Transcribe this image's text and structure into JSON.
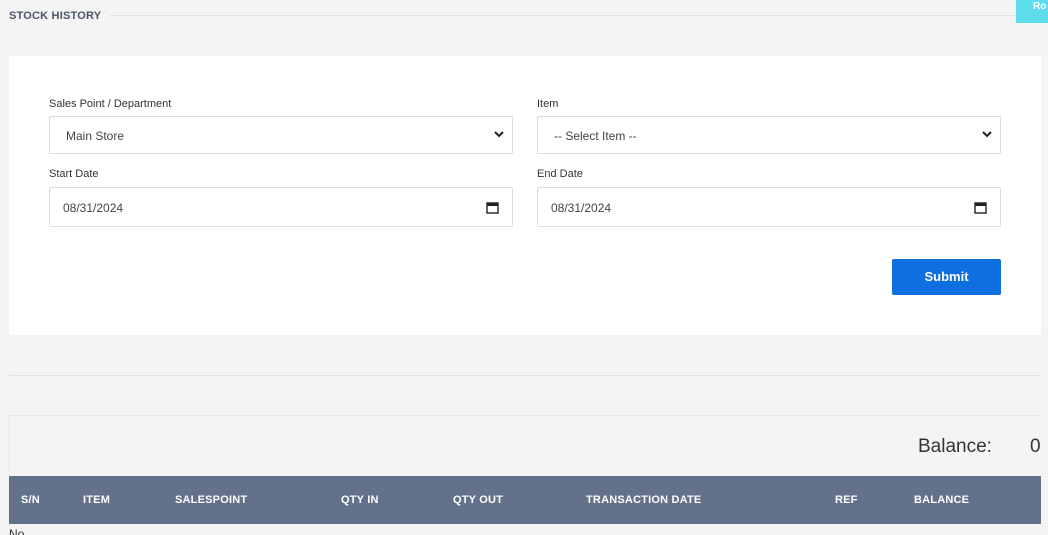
{
  "page": {
    "title": "STOCK HISTORY",
    "corner_button_label": "Ro"
  },
  "form": {
    "sales_point": {
      "label": "Sales Point / Department",
      "value": "Main Store"
    },
    "item": {
      "label": "Item",
      "value": "-- Select Item --"
    },
    "start_date": {
      "label": "Start Date",
      "value": "08/31/2024"
    },
    "end_date": {
      "label": "End Date",
      "value": "08/31/2024"
    },
    "submit_label": "Submit"
  },
  "summary": {
    "balance_label": "Balance:",
    "balance_value": "0"
  },
  "table": {
    "columns": [
      "S/N",
      "ITEM",
      "SALESPOINT",
      "QTY IN",
      "QTY OUT",
      "TRANSACTION DATE",
      "REF",
      "BALANCE"
    ],
    "empty_text": "No"
  },
  "colors": {
    "header_bg": "#63728a",
    "submit_bg": "#0e6fe0",
    "corner_btn_bg": "#5ddcec"
  },
  "icons": [
    "chevron-down-icon",
    "calendar-icon"
  ]
}
